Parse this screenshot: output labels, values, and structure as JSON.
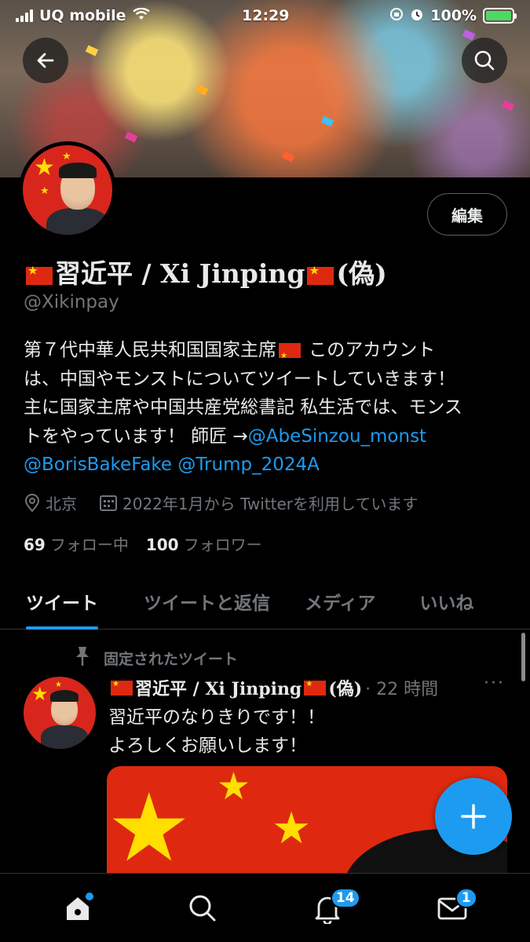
{
  "status_bar": {
    "carrier": "UQ mobile",
    "time": "12:29",
    "battery": "100%",
    "battery_level": 1.0
  },
  "profile": {
    "display_name": "習近平 / Xi Jinping",
    "display_suffix": "(偽)",
    "handle": "@Xikinpay",
    "edit_label": "編集",
    "bio_line1_a": "第７代中華人民共和国国家主席",
    "bio_line1_b": " このアカウント",
    "bio_line2": "は、中国やモンストについてツイートしていきます！",
    "bio_line3": "主に国家主席や中国共産党総書記 私生活では、モンス",
    "bio_line4_text": "トをやっています！ 師匠 →",
    "bio_mention1": "@AbeSinzou_monst",
    "bio_mention2": "@BorisBakeFake",
    "bio_mention3": "@Trump_2024A",
    "location": "北京",
    "joined": "2022年1月から Twitterを利用しています",
    "following_count": "69",
    "following_label": "フォロー中",
    "followers_count": "100",
    "followers_label": "フォロワー"
  },
  "tabs": [
    {
      "label": "ツイート"
    },
    {
      "label": "ツイートと返信"
    },
    {
      "label": "メディア"
    },
    {
      "label": "いいね"
    }
  ],
  "pinned_label": "固定されたツイート",
  "tweet": {
    "name": "習近平 / Xi Jinping",
    "suffix": "(偽)",
    "time": "· 22 時間",
    "more": "···",
    "line1": "習近平のなりきりです！！",
    "line2": "よろしくお願いします！"
  },
  "nav": {
    "notifications_badge": "14",
    "messages_badge": "1"
  },
  "colors": {
    "accent": "#1d9bf0",
    "background": "#000000",
    "muted": "#71767b",
    "flag_red": "#de2910",
    "flag_yellow": "#ffde00"
  },
  "icons": [
    "back-arrow-icon",
    "search-icon",
    "location-icon",
    "calendar-icon",
    "pin-icon",
    "more-icon",
    "compose-plus-icon",
    "home-icon",
    "search-nav-icon",
    "bell-icon",
    "mail-icon"
  ]
}
